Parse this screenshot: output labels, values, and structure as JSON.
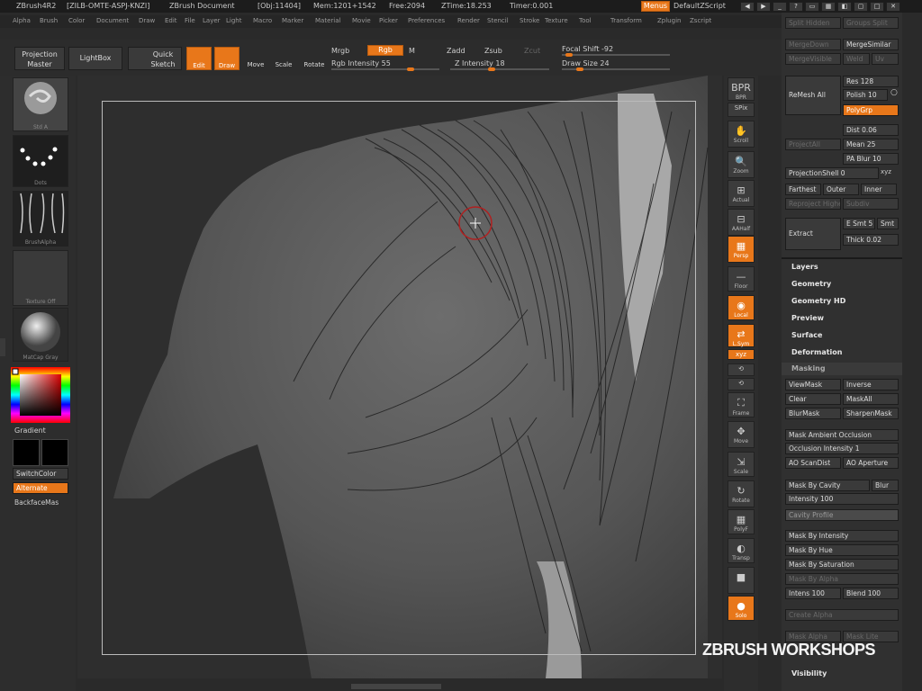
{
  "titlebar": {
    "app": "ZBrush4R2",
    "code": "[ZILB-OMTE-ASPJ-KNZI]",
    "doc": "ZBrush Document",
    "obj": "[Obj:11404]",
    "mem": "Mem:1201+1542",
    "free": "Free:2094",
    "ztime": "ZTime:18.253",
    "timer": "Timer:0.001",
    "menus": "Menus",
    "script": "DefaultZScript"
  },
  "menubar": [
    "Alpha",
    "Brush",
    "Color",
    "Document",
    "Draw",
    "Edit",
    "File",
    "Layer",
    "Light",
    "Macro",
    "Marker",
    "Material",
    "Movie",
    "Picker",
    "Preferences",
    "Render",
    "Stencil",
    "Stroke",
    "Texture",
    "Tool",
    "Transform",
    "Zplugin",
    "Zscript"
  ],
  "topbar": {
    "projection_master": "Projection Master",
    "lightbox": "LightBox",
    "quick_sketch": "Quick Sketch",
    "edit": "Edit",
    "draw": "Draw",
    "move": "Move",
    "scale": "Scale",
    "rotate": "Rotate",
    "mrgb": "Mrgb",
    "rgb": "Rgb",
    "m": "M",
    "zadd": "Zadd",
    "zsub": "Zsub",
    "zcut": "Zcut",
    "rgb_intensity": "Rgb Intensity 55",
    "z_intensity": "Z Intensity 18",
    "focal_shift": "Focal Shift -92",
    "draw_size": "Draw Size 24"
  },
  "leftshelf": {
    "brush_cap": "Std A",
    "stroke_cap": "Dots",
    "alpha_cap": "BrushAlpha",
    "texture_cap": "Texture Off",
    "material_cap": "MatCap Gray",
    "gradient": "Gradient",
    "switchcolor": "SwitchColor",
    "alternate": "Alternate",
    "backface": "BackfaceMas"
  },
  "rightshelf": [
    {
      "icon": "BPR",
      "label": "BPR",
      "on": false
    },
    {
      "icon": "SPix",
      "label": "SPix",
      "on": false
    },
    {
      "icon": "✋",
      "label": "Scroll",
      "on": false
    },
    {
      "icon": "🔍",
      "label": "Zoom",
      "on": false
    },
    {
      "icon": "⊞",
      "label": "Actual",
      "on": false
    },
    {
      "icon": "⊟",
      "label": "AAHalf",
      "on": false
    },
    {
      "icon": "▦",
      "label": "Persp",
      "on": true
    },
    {
      "icon": "—",
      "label": "Floor",
      "on": false
    },
    {
      "icon": "◉",
      "label": "Local",
      "on": true
    },
    {
      "icon": "⇄",
      "label": "L.Sym",
      "on": true
    },
    {
      "icon": "xyz",
      "label": "XYZ",
      "on": true
    },
    {
      "icon": "⟲",
      "label": "",
      "on": false
    },
    {
      "icon": "⟲",
      "label": "",
      "on": false
    },
    {
      "icon": "⛶",
      "label": "Frame",
      "on": false
    },
    {
      "icon": "✥",
      "label": "Move",
      "on": false
    },
    {
      "icon": "⇲",
      "label": "Scale",
      "on": false
    },
    {
      "icon": "↻",
      "label": "Rotate",
      "on": false
    },
    {
      "icon": "▦",
      "label": "PolyF",
      "on": false
    },
    {
      "icon": "◐",
      "label": "Transp",
      "on": false
    },
    {
      "icon": "■",
      "label": "",
      "on": false
    },
    {
      "icon": "●",
      "label": "Solo",
      "on": true
    }
  ],
  "panel": {
    "split_hidden": "Split Hidden",
    "groups_split": "Groups Split",
    "merge_down": "MergeDown",
    "merge_similar": "MergeSimilar",
    "merge_visible": "MergeVisible",
    "weld": "Weld",
    "uv": "Uv",
    "remesh_all": "ReMesh All",
    "res": "Res 128",
    "polish": "Polish 10",
    "polygrp": "PolyGrp",
    "project_all": "ProjectAll",
    "dist": "Dist 0.06",
    "mean": "Mean 25",
    "pa_blur": "PA Blur 10",
    "projection_shell": "ProjectionShell 0",
    "xyz": "xyz",
    "farthest": "Farthest",
    "outer": "Outer",
    "inner": "Inner",
    "reproject_higher": "Reproject Higher",
    "subdiv": "Subdiv",
    "extract": "Extract",
    "e_smt": "E Smt 5",
    "s_smt": "Smt",
    "thick": "Thick 0.02",
    "sections": [
      "Layers",
      "Geometry",
      "Geometry HD",
      "Preview",
      "Surface",
      "Deformation"
    ],
    "masking": "Masking",
    "viewmask": "ViewMask",
    "inverse": "Inverse",
    "clear": "Clear",
    "maskall": "MaskAll",
    "blurmask": "BlurMask",
    "sharpenmask": "SharpenMask",
    "mask_ao": "Mask Ambient Occlusion",
    "occ_intensity": "Occlusion Intensity 1",
    "ao_scandist": "AO ScanDist",
    "ao_aperture": "AO Aperture",
    "mask_cavity": "Mask By Cavity",
    "blur": "Blur",
    "intensity": "Intensity 100",
    "cavity_profile": "Cavity Profile",
    "mask_intensity": "Mask By Intensity",
    "mask_hue": "Mask By Hue",
    "mask_saturation": "Mask By Saturation",
    "mask_alpha": "Mask By Alpha",
    "intens": "Intens 100",
    "blend": "Blend 100",
    "create_alpha": "Create Alpha",
    "mask_alpha2": "Mask Alpha",
    "mask_lite": "Mask Lite",
    "visibility": "Visibility"
  },
  "watermark": "ZBRUSH WORKSHOPS",
  "colors": {
    "accent": "#e8771a",
    "bg": "#2a2a2a",
    "panel": "#303030"
  }
}
